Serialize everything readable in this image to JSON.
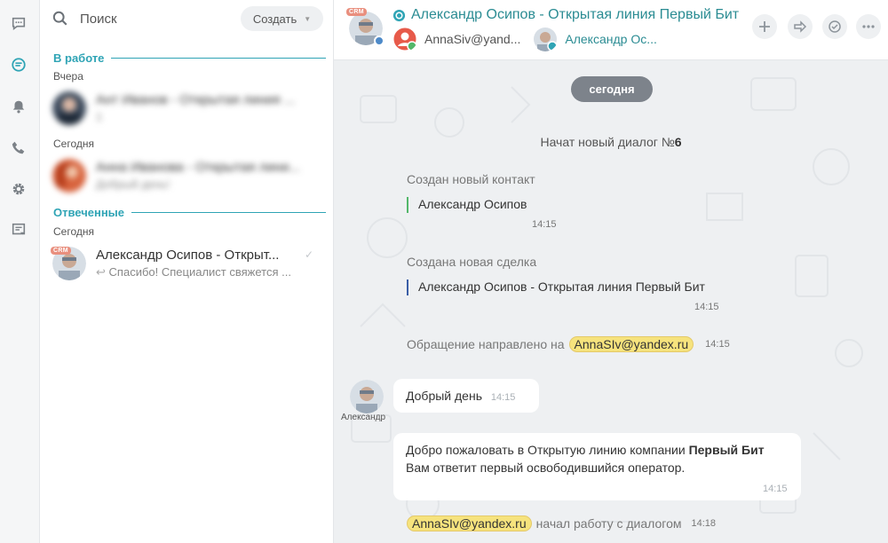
{
  "colors": {
    "accent": "#2fa4b5",
    "title": "#2b8c93",
    "mention": "#f6e37d",
    "crm": "#e98f7e",
    "pill": "#7d838b"
  },
  "rail": {
    "icons": [
      "chat-icon",
      "open-lines-icon",
      "bell-icon",
      "phone-icon",
      "gear-icon",
      "notes-icon"
    ]
  },
  "search": {
    "placeholder": "Поиск"
  },
  "create_button": {
    "label": "Создать"
  },
  "sections": {
    "in_work": "В работе",
    "answered": "Отвеченные"
  },
  "days": {
    "yesterday": "Вчера",
    "today1": "Сегодня",
    "today2": "Сегодня"
  },
  "recent": [
    {
      "name": "Ант Иванов - Открытая линия ...",
      "message": "1"
    },
    {
      "name": "Анна Иванова - Открытая лини...",
      "message": "Добрый день!"
    },
    {
      "name": "Александр Осипов - Открыт...",
      "message": "Спасибо! Специалист свяжется ...",
      "badge": "CRM"
    }
  ],
  "header": {
    "badge": "CRM",
    "title": "Александр Осипов - Открытая линия Первый Бит",
    "user1": "AnnaSiv@yand...",
    "user2": "Александр Ос..."
  },
  "dialog": {
    "date_pill": "сегодня",
    "started_prefix": "Начат новый диалог №",
    "started_num": "6",
    "contact_title": "Создан новый контакт",
    "contact_name": "Александр Осипов",
    "contact_time": "14:15",
    "deal_title": "Создана новая сделка",
    "deal_name": "Александр Осипов - Открытая линия Первый Бит",
    "deal_time": "14:15",
    "routed_prefix": "Обращение направлено на",
    "routed_to": "AnnaSIv@yandex.ru",
    "routed_time": "14:15",
    "user_name": "Александр",
    "msg1_text": "Добрый день",
    "msg1_time": "14:15",
    "msg2_line1": "Добро пожаловать в Открытую линию компании",
    "msg2_bold": "Первый Бит",
    "msg2_line2": "Вам ответит первый освободившийся оператор.",
    "msg2_time": "14:15",
    "started_by": "AnnaSIv@yandex.ru",
    "started_suffix": "начал работу с диалогом",
    "started_time": "14:18"
  }
}
